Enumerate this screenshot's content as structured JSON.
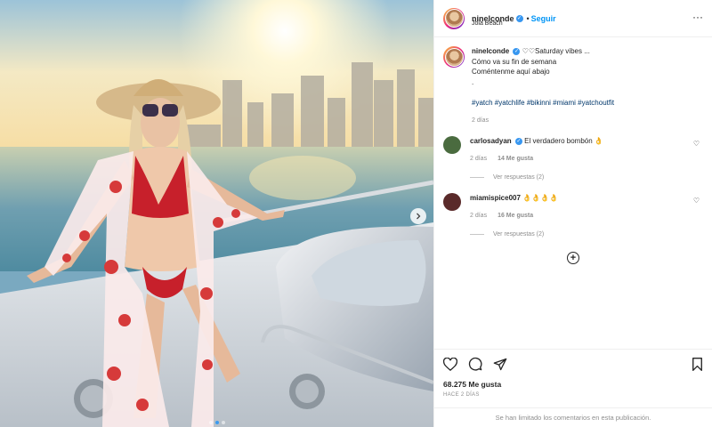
{
  "post": {
    "username": "ninelconde",
    "follow_label": "Seguir",
    "location": "Joia Beach",
    "more_label": "···"
  },
  "caption": {
    "username": "ninelconde",
    "line1": "♡♡Saturday vibes ...",
    "line2": "Cómo va su fin de semana",
    "line3": "Coméntenme aquí abajo",
    "line4": ".",
    "hashtags": "#yatch #yatchlife #bikinni #miami #yatchoutfit",
    "time": "2 días"
  },
  "comments": [
    {
      "username": "carlosadyan",
      "text": "El verdadero bombón 👌",
      "time": "2 días",
      "likes": "14 Me gusta",
      "replies": "Ver respuestas (2)",
      "avatar_color": "#4a6b3f"
    },
    {
      "username": "miamispice007",
      "text": "👌👌👌👌",
      "time": "2 días",
      "likes": "16 Me gusta",
      "replies": "Ver respuestas (2)",
      "avatar_color": "#5a2a2a"
    }
  ],
  "load_more": "+",
  "footer": {
    "likes": "68.275 Me gusta",
    "ago": "HACE 2 DÍAS",
    "limited": "Se han limitado los comentarios en esta publicación."
  },
  "icons": {
    "like": "heart-icon",
    "comment": "comment-icon",
    "share": "share-icon",
    "save": "bookmark-icon",
    "next": "chevron-right-icon",
    "verified": "verified-icon"
  },
  "colors": {
    "accent": "#0095f6",
    "verified": "#3897f0",
    "hashtag": "#00376b",
    "muted": "#8e8e8e"
  },
  "carousel": {
    "slide_count": 3,
    "active_slide": 2
  }
}
